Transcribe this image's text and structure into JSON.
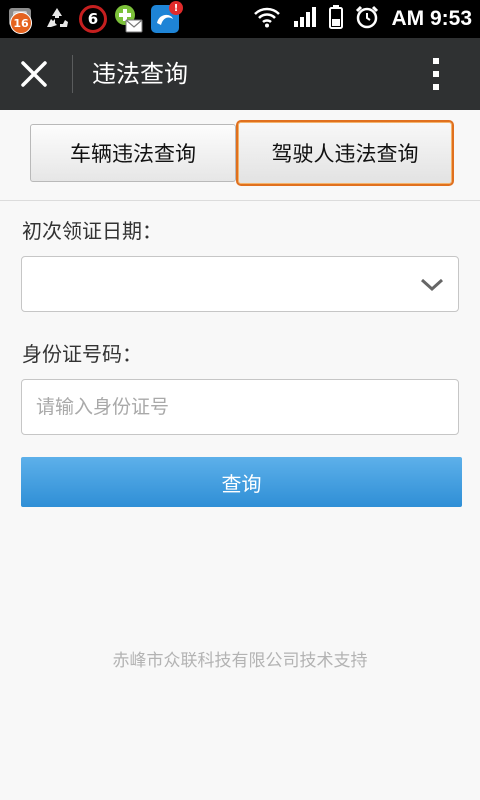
{
  "status_bar": {
    "notification_badge": "16",
    "counter_icon_value": "6",
    "time": "AM 9:53",
    "icons": [
      "app-notification-icon",
      "recycle-icon",
      "counter-icon",
      "messaging-icon",
      "browser-app-icon",
      "wifi-icon",
      "signal-icon",
      "battery-icon",
      "alarm-icon"
    ]
  },
  "title_bar": {
    "title": "违法查询",
    "close_icon": "close-icon",
    "more_icon": "more-vertical-icon"
  },
  "tabs": [
    {
      "label": "车辆违法查询",
      "selected": false
    },
    {
      "label": "驾驶人违法查询",
      "selected": true
    }
  ],
  "form": {
    "date_label": "初次领证日期：",
    "date_value": "",
    "id_label": "身份证号码：",
    "id_placeholder": "请输入身份证号",
    "id_value": "",
    "submit_label": "查询"
  },
  "footer": "赤峰市众联科技有限公司技术支持",
  "colors": {
    "title_bar": "#2f3132",
    "selected_tab_border": "#e0701e",
    "button": "#3d9be0",
    "status_bar": "#000000"
  }
}
